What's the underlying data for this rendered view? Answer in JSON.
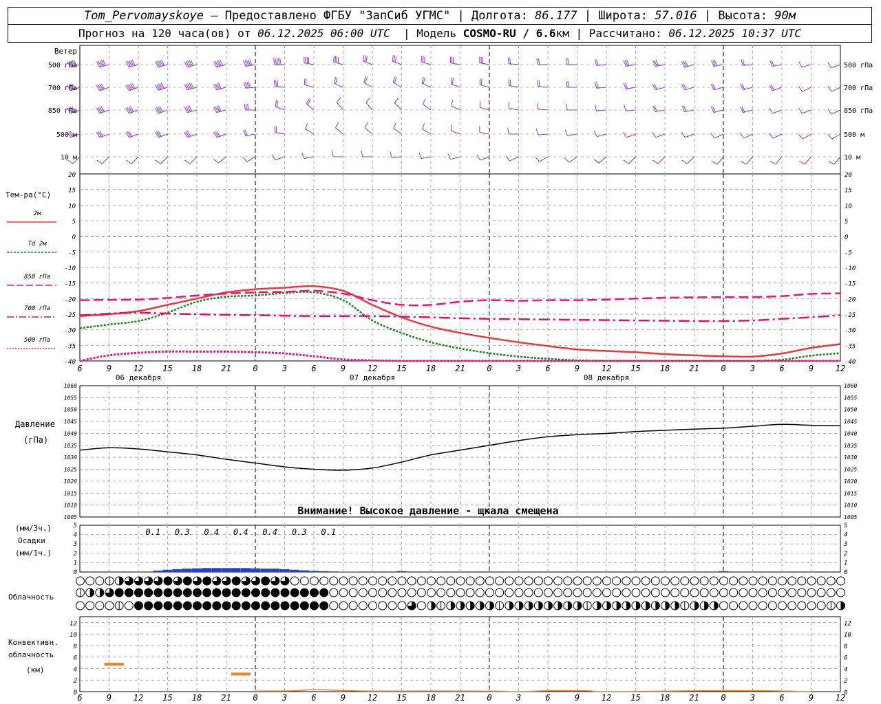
{
  "header": {
    "station": "Tom_Pervomayskoye",
    "provider": "– Предоставлено ФГБУ \"ЗапСиб УГМС\"",
    "lon_label": "| Долгота:",
    "lon": "86.177",
    "lat_label": "| Широта:",
    "lat": "57.016",
    "alt_label": "| Высота:",
    "alt": "90м",
    "forecast_label": "Прогноз на 120 часа(ов) от",
    "run_time": "06.12.2025 06:00 UTC",
    "model_label": "| Модель",
    "model": "COSMO-RU / 6.6",
    "model_unit": "км",
    "calc_label": "| Рассчитано:",
    "calc_time": "06.12.2025 10:37 UTC"
  },
  "labels": {
    "wind": "Ветер",
    "wind_levels": [
      "500 гПа",
      "700 гПа",
      "850 гПа",
      "500 м",
      "10 м"
    ],
    "temp_title": "Тем-ра(°С)",
    "legend": [
      "2м",
      "Td 2м",
      "850 гПа",
      "700 гПа",
      "500 гПа"
    ],
    "pressure": [
      "Давление",
      "(гПа)"
    ],
    "warning": "Внимание! Высокое давление - щкала смещена",
    "precip": [
      "(мм/3ч.)",
      "Осадки",
      "(мм/1ч.)"
    ],
    "cloud": "Облачность",
    "conv": [
      "Конвективн.",
      "облачность",
      "(км)"
    ]
  },
  "colors": {
    "t2m": "#e8383c",
    "td2m": "#118811",
    "t850": "#ee1177",
    "t700": "#dd1166",
    "t500": "#ee1177",
    "wind": "#8a3ad8",
    "precip": "#2244cc",
    "conv": "#e8842a",
    "zero": "#3355ff"
  },
  "chart_data": [
    {
      "type": "line",
      "title": "Тем-ра(°С)",
      "ylim": [
        -40,
        20
      ],
      "yticks": [
        20,
        15,
        10,
        5,
        0,
        -5,
        -10,
        -15,
        -20,
        -25,
        -30,
        -35,
        -40
      ],
      "x_hours": [
        0,
        3,
        6,
        9,
        12,
        15,
        18,
        21,
        24,
        27,
        30,
        33,
        36,
        39,
        42,
        45,
        48,
        51,
        54,
        57,
        60,
        63,
        66,
        69,
        72,
        75,
        78
      ],
      "x_tick_labels": [
        "6",
        "9",
        "12",
        "15",
        "18",
        "21",
        "0",
        "3",
        "6",
        "9",
        "12",
        "15",
        "18",
        "21",
        "0",
        "3",
        "6",
        "9",
        "12",
        "15",
        "18",
        "21",
        "0",
        "3",
        "6",
        "9",
        "12"
      ],
      "date_labels": [
        {
          "hour": 6,
          "text": "06 декабря"
        },
        {
          "hour": 30,
          "text": "07 декабря"
        },
        {
          "hour": 54,
          "text": "08 декабря"
        }
      ],
      "grid": true,
      "series": [
        {
          "name": "2м",
          "hours": [
            0,
            3,
            6,
            9,
            12,
            15,
            18,
            21,
            24,
            27,
            30,
            33,
            36,
            39,
            42,
            45,
            48,
            51,
            54,
            57,
            60,
            63,
            66,
            69,
            72,
            75,
            78
          ],
          "values": [
            -25.6,
            -25,
            -24,
            -22,
            -20,
            -18,
            -17,
            -16.5,
            -16,
            -17.5,
            -22,
            -26,
            -29,
            -31,
            -32.6,
            -34,
            -35.2,
            -36.3,
            -36.8,
            -37.2,
            -37.8,
            -38.2,
            -38.5,
            -38.6,
            -37.6,
            -35.8,
            -34.6
          ]
        },
        {
          "name": "Td 2м",
          "hours": [
            0,
            3,
            6,
            9,
            12,
            15,
            18,
            21,
            24,
            27,
            30,
            33,
            36,
            39,
            42,
            45,
            48,
            51,
            54,
            57,
            60,
            63,
            66,
            69,
            72,
            75,
            78
          ],
          "values": [
            -29.5,
            -28.3,
            -27.2,
            -24.5,
            -21,
            -19.4,
            -19,
            -18.2,
            -18,
            -20.5,
            -27,
            -31,
            -34,
            -36,
            -37.5,
            -38.6,
            -39.3,
            -39.8,
            -40,
            -40,
            -40,
            -40,
            -40,
            -40,
            -39.6,
            -38.3,
            -37.5
          ]
        },
        {
          "name": "850 гПа",
          "hours": [
            0,
            3,
            6,
            9,
            12,
            15,
            18,
            21,
            24,
            27,
            30,
            33,
            36,
            39,
            42,
            45,
            48,
            51,
            54,
            57,
            60,
            63,
            66,
            69,
            72,
            75,
            78
          ],
          "values": [
            -20.5,
            -20.4,
            -20.3,
            -19.8,
            -19,
            -18.4,
            -18,
            -17.8,
            -17.5,
            -18.4,
            -20.5,
            -22,
            -22,
            -21,
            -20.5,
            -20.7,
            -20.5,
            -20.5,
            -20.3,
            -20,
            -19.7,
            -19.6,
            -19.5,
            -19.5,
            -19.2,
            -18.5,
            -18.3
          ]
        },
        {
          "name": "700 гПа",
          "hours": [
            0,
            3,
            6,
            9,
            12,
            15,
            18,
            21,
            24,
            27,
            30,
            33,
            36,
            39,
            42,
            45,
            48,
            51,
            54,
            57,
            60,
            63,
            66,
            69,
            72,
            75,
            78
          ],
          "values": [
            -25.4,
            -24.8,
            -24.5,
            -24.8,
            -25,
            -25.2,
            -25.3,
            -25.5,
            -25.6,
            -25.6,
            -25.6,
            -25.8,
            -26,
            -26.3,
            -26.5,
            -26.6,
            -26.7,
            -26.8,
            -26.9,
            -27,
            -27.1,
            -27.2,
            -27.2,
            -27,
            -26.5,
            -26,
            -25.3
          ]
        },
        {
          "name": "500 гПа",
          "hours": [
            0,
            3,
            6,
            9,
            12,
            15,
            18,
            21,
            24,
            27,
            30,
            33,
            36,
            39,
            42,
            45,
            48,
            51,
            54,
            57,
            60,
            63,
            66,
            69,
            72,
            75,
            78
          ],
          "values": [
            -40,
            -38.2,
            -37.4,
            -37,
            -37,
            -37,
            -37.2,
            -37.6,
            -38.5,
            -39.5,
            -39.8,
            -40,
            -40,
            -40,
            -40,
            -40,
            -40,
            -40,
            -40,
            -40,
            -40,
            -40,
            -40,
            -40,
            -40,
            -40,
            -40
          ]
        }
      ]
    },
    {
      "type": "line",
      "title": "Давление",
      "ylabel": "(гПа)",
      "ylim": [
        1005,
        1060
      ],
      "yticks": [
        1060,
        1055,
        1050,
        1045,
        1040,
        1035,
        1030,
        1025,
        1020,
        1015,
        1010,
        1005
      ],
      "series": [
        {
          "name": "Давление",
          "hours": [
            0,
            3,
            6,
            9,
            12,
            15,
            18,
            21,
            24,
            27,
            30,
            33,
            36,
            39,
            42,
            45,
            48,
            51,
            54,
            57,
            60,
            63,
            66,
            69,
            72,
            75,
            78
          ],
          "values": [
            1033,
            1034,
            1033.5,
            1032.3,
            1031,
            1029.2,
            1027.6,
            1026,
            1025,
            1024.6,
            1025.5,
            1028,
            1031,
            1033,
            1035,
            1037,
            1038.6,
            1039.5,
            1040,
            1040.8,
            1041.3,
            1041.8,
            1042.2,
            1043,
            1043.8,
            1043.4,
            1043.2
          ]
        }
      ]
    },
    {
      "type": "bar",
      "title": "Осадки",
      "ylim": [
        0,
        5
      ],
      "left_ticks": [
        5,
        4,
        3,
        2,
        1,
        0
      ],
      "amount_hours": [
        7.5,
        10.5,
        13.5,
        16.5,
        19.5,
        22.5,
        25.5
      ],
      "amounts_3h": [
        "0.1",
        "0.3",
        "0.4",
        "0.4",
        "0.4",
        "0.3",
        "0.1"
      ],
      "hourly_hours": [
        8,
        9,
        10,
        11,
        12,
        13,
        14,
        15,
        16,
        17,
        18,
        19,
        20,
        21,
        22,
        23,
        24,
        25,
        26,
        27,
        28,
        33,
        66
      ],
      "hourly_mm": [
        0.05,
        0.08,
        0.1,
        0.12,
        0.13,
        0.14,
        0.14,
        0.14,
        0.14,
        0.14,
        0.13,
        0.12,
        0.12,
        0.1,
        0.08,
        0.06,
        0.04,
        0.03,
        0.02,
        0.01,
        0.01,
        0.03,
        0.03
      ]
    },
    {
      "type": "table",
      "title": "Облачность",
      "symbol_hours": [
        0,
        1,
        2,
        3,
        4,
        5,
        6,
        7,
        8,
        9,
        10,
        11,
        12,
        13,
        14,
        15,
        16,
        17,
        18,
        19,
        20,
        21,
        22,
        23,
        24,
        25,
        26,
        27,
        28,
        29,
        30,
        31,
        32,
        33,
        34,
        35,
        36,
        37,
        38,
        39,
        40,
        41,
        42,
        43,
        44,
        45,
        46,
        47,
        48,
        49,
        50,
        51,
        52,
        53,
        54,
        55,
        56,
        57,
        58,
        59,
        60,
        61,
        62,
        63,
        64,
        65,
        66,
        67,
        68,
        69,
        70,
        71,
        72,
        73,
        74,
        75,
        76,
        77,
        78
      ],
      "rows": [
        [
          0,
          0,
          0,
          2,
          4,
          6,
          6,
          6,
          6,
          8,
          6,
          8,
          6,
          8,
          6,
          6,
          8,
          6,
          6,
          8,
          6,
          6,
          0,
          0,
          0,
          0,
          0,
          0,
          0,
          0,
          0,
          0,
          0,
          0,
          0,
          0,
          0,
          0,
          0,
          0,
          0,
          0,
          0,
          0,
          0,
          0,
          0,
          0,
          0,
          0,
          0,
          0,
          0,
          0,
          0,
          0,
          0,
          0,
          0,
          0,
          0,
          0,
          0,
          0,
          0,
          0,
          0,
          0,
          0,
          0,
          0,
          0,
          0,
          0,
          0,
          0,
          0,
          0,
          0
        ],
        [
          2,
          4,
          4,
          6,
          8,
          8,
          8,
          8,
          8,
          8,
          8,
          8,
          8,
          8,
          8,
          8,
          8,
          8,
          8,
          8,
          8,
          8,
          8,
          8,
          8,
          8,
          0,
          0,
          0,
          0,
          0,
          0,
          0,
          0,
          0,
          0,
          0,
          0,
          0,
          0,
          0,
          0,
          0,
          0,
          0,
          0,
          0,
          0,
          0,
          0,
          0,
          0,
          0,
          0,
          0,
          0,
          0,
          0,
          0,
          0,
          0,
          0,
          0,
          0,
          0,
          0,
          0,
          0,
          0,
          0,
          0,
          0,
          0,
          0,
          0,
          0,
          0,
          0,
          0
        ],
        [
          0,
          0,
          0,
          0,
          2,
          0,
          8,
          8,
          8,
          8,
          8,
          8,
          8,
          8,
          8,
          8,
          8,
          8,
          8,
          8,
          8,
          8,
          8,
          8,
          8,
          8,
          0,
          0,
          0,
          0,
          0,
          0,
          0,
          0,
          6,
          0,
          4,
          2,
          4,
          4,
          4,
          4,
          4,
          2,
          4,
          4,
          4,
          4,
          4,
          4,
          4,
          4,
          2,
          4,
          4,
          4,
          4,
          4,
          4,
          4,
          4,
          4,
          2,
          4,
          4,
          4,
          0,
          0,
          0,
          0,
          0,
          0,
          0,
          0,
          0,
          0,
          0,
          2,
          4
        ]
      ]
    },
    {
      "type": "bar",
      "title": "Конвективн. облачность",
      "ylabel": "(км)",
      "ylim": [
        0,
        13
      ],
      "yticks": [
        0,
        2,
        4,
        6,
        8,
        10,
        12
      ],
      "segments": [
        {
          "from": 2.5,
          "to": 4.5,
          "base": 4.5,
          "top": 5
        },
        {
          "from": 15.5,
          "to": 17.5,
          "base": 2.8,
          "top": 3.3
        }
      ],
      "surface_hours": [
        18,
        22,
        24,
        26,
        28,
        30,
        42,
        45,
        48,
        52,
        54,
        64,
        70,
        75
      ],
      "surface_km": [
        0.1,
        0.15,
        0.35,
        0.25,
        0.15,
        0.1,
        0.1,
        0,
        0.15,
        0.15,
        0,
        0.15,
        0.15,
        0
      ]
    }
  ],
  "wind_levels_data": [
    {
      "level": "500 гПа",
      "directions_deg": [
        255,
        255,
        255,
        255,
        255,
        255,
        260,
        270,
        280,
        285,
        290,
        290,
        285,
        280,
        280,
        275,
        270,
        270,
        265,
        260,
        260,
        255,
        260,
        265,
        260,
        255,
        250
      ],
      "speeds_ms": [
        27,
        28,
        29,
        30,
        30,
        30,
        27,
        24,
        20,
        18,
        17,
        15,
        14,
        14,
        13,
        12,
        12,
        12,
        12,
        13,
        14,
        14,
        14,
        12,
        9,
        6,
        5
      ]
    },
    {
      "level": "700 гПа",
      "directions_deg": [
        250,
        250,
        250,
        252,
        255,
        255,
        265,
        275,
        285,
        295,
        300,
        300,
        295,
        290,
        285,
        280,
        275,
        270,
        265,
        260,
        255,
        255,
        255,
        255,
        250,
        245,
        245
      ],
      "speeds_ms": [
        20,
        22,
        23,
        23,
        23,
        22,
        18,
        14,
        12,
        10,
        9,
        8,
        8,
        8,
        8,
        8,
        8,
        8,
        9,
        9,
        10,
        10,
        10,
        9,
        8,
        7,
        6
      ]
    },
    {
      "level": "850 гПа",
      "directions_deg": [
        250,
        250,
        250,
        250,
        255,
        255,
        270,
        290,
        310,
        320,
        320,
        315,
        305,
        295,
        285,
        280,
        275,
        270,
        265,
        265,
        260,
        260,
        255,
        255,
        250,
        250,
        245
      ],
      "speeds_ms": [
        18,
        19,
        20,
        20,
        20,
        18,
        14,
        10,
        8,
        7,
        6,
        6,
        6,
        6,
        6,
        6,
        6,
        6,
        7,
        7,
        8,
        8,
        8,
        8,
        7,
        6,
        6
      ]
    },
    {
      "level": "500 м",
      "directions_deg": [
        250,
        250,
        250,
        250,
        250,
        250,
        260,
        280,
        300,
        310,
        310,
        305,
        300,
        290,
        280,
        270,
        265,
        260,
        255,
        250,
        250,
        250,
        245,
        245,
        245,
        240,
        240
      ],
      "speeds_ms": [
        14,
        15,
        15,
        15,
        15,
        14,
        12,
        9,
        7,
        6,
        6,
        6,
        6,
        6,
        6,
        6,
        6,
        6,
        7,
        7,
        7,
        7,
        7,
        7,
        6,
        6,
        6
      ]
    },
    {
      "level": "10 м",
      "directions_deg": [
        225,
        225,
        225,
        225,
        225,
        230,
        240,
        250,
        260,
        270,
        270,
        265,
        260,
        255,
        250,
        245,
        240,
        235,
        230,
        225,
        225,
        225,
        220,
        220,
        220,
        220,
        220
      ],
      "speeds_ms": [
        5,
        5,
        5,
        5,
        5,
        4,
        3,
        3,
        3,
        3,
        3,
        3,
        3,
        3,
        3,
        3,
        3,
        3,
        3,
        3,
        3,
        3,
        3,
        3,
        3,
        3,
        3
      ]
    }
  ]
}
